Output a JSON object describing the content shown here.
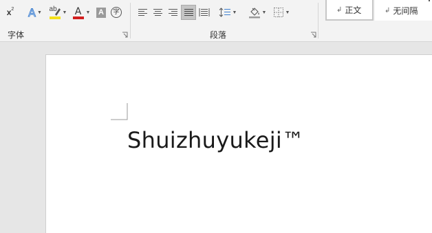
{
  "ribbon": {
    "font_group": {
      "label": "字体",
      "superscript": {
        "base": "x",
        "exp": "2"
      },
      "text_effects_letter": "A",
      "highlight_letters": "ab",
      "highlight_color": "#f5e11a",
      "font_color_letter": "A",
      "font_color": "#d21f1f",
      "char_shading_letter": "A",
      "enclose_char": "字"
    },
    "paragraph_group": {
      "label": "段落"
    },
    "styles": {
      "items": [
        {
          "mark": "↲",
          "label": "正文"
        },
        {
          "mark": "↲",
          "label": "无间隔"
        }
      ]
    }
  },
  "document": {
    "text": "Shuizhuyukeji™"
  }
}
